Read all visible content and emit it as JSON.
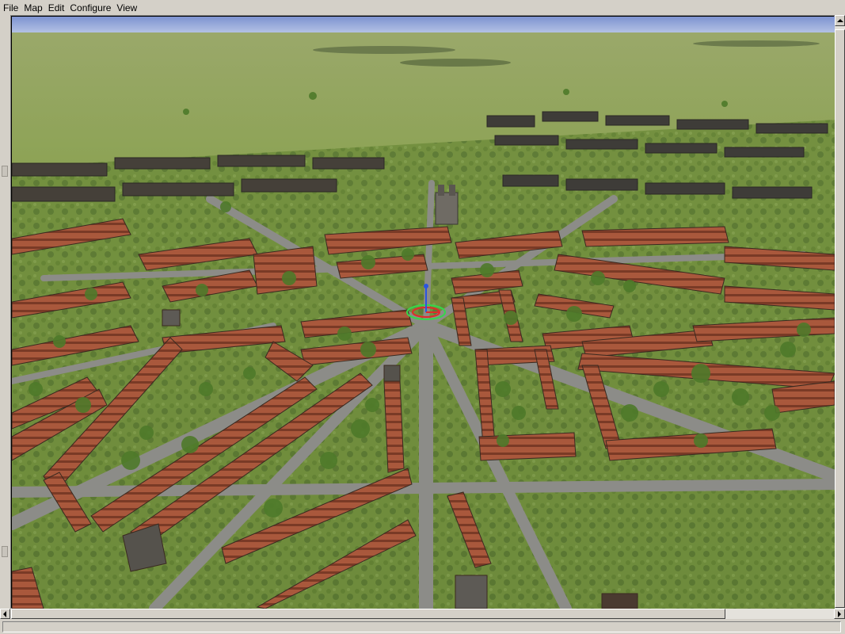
{
  "menu": [
    "File",
    "Map",
    "Edit",
    "Configure",
    "View"
  ],
  "status": {
    "text": ""
  },
  "colors": {
    "sky": "#8fa3d6",
    "grass": "#7e9a48",
    "roof": "#a85a3e",
    "road": "#8a8a86",
    "tree": "#4e7a2a"
  },
  "icons": {
    "gizmo": "object-gizmo-icon"
  }
}
